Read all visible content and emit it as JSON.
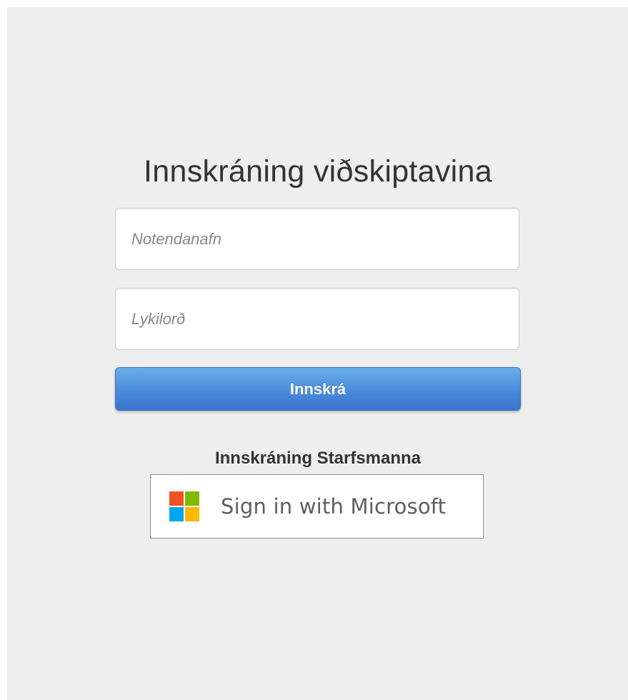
{
  "customer_login": {
    "title": "Innskráning viðskiptavina",
    "username_placeholder": "Notendanafn",
    "password_placeholder": "Lykilorð",
    "login_button_label": "Innskrá"
  },
  "staff_login": {
    "heading": "Innskráning Starfsmanna",
    "microsoft_button_label": "Sign in with Microsoft",
    "microsoft_logo_icon": "microsoft-logo-icon"
  },
  "colors": {
    "page_background": "#eeeeee",
    "login_button_top": "#6aaee8",
    "login_button_bottom": "#3a73cc",
    "ms_red": "#f25022",
    "ms_green": "#7fba00",
    "ms_blue": "#00a4ef",
    "ms_yellow": "#ffb900"
  }
}
